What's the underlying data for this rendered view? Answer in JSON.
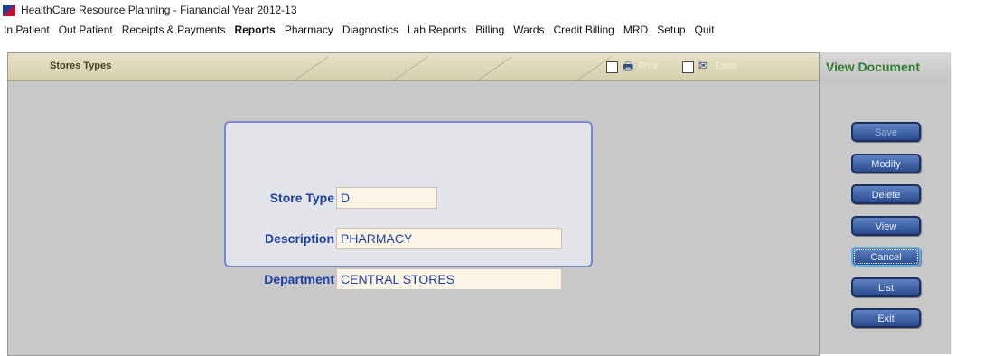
{
  "app": {
    "title": "HealthCare Resource Planning - Fianancial Year 2012-13"
  },
  "menu": [
    {
      "label": "In Patient",
      "bold": false
    },
    {
      "label": "Out Patient",
      "bold": false
    },
    {
      "label": "Receipts & Payments",
      "bold": false
    },
    {
      "label": "Reports",
      "bold": true
    },
    {
      "label": "Pharmacy",
      "bold": false
    },
    {
      "label": "Diagnostics",
      "bold": false
    },
    {
      "label": "Lab Reports",
      "bold": false
    },
    {
      "label": "Billing",
      "bold": false
    },
    {
      "label": "Wards",
      "bold": false
    },
    {
      "label": "Credit Billing",
      "bold": false
    },
    {
      "label": "MRD",
      "bold": false
    },
    {
      "label": "Setup",
      "bold": false
    },
    {
      "label": "Quit",
      "bold": false
    }
  ],
  "toolbar": {
    "title": "Stores Types",
    "print_label": "Print",
    "email_label": "Email"
  },
  "form": {
    "store_type": {
      "label": "Store Type",
      "value": "D"
    },
    "description": {
      "label": "Description",
      "value": "PHARMACY"
    },
    "department": {
      "label": "Department",
      "value": "CENTRAL STORES"
    }
  },
  "sidebar": {
    "title": "View Document",
    "buttons": {
      "save": "Save",
      "modify": "Modify",
      "delete": "Delete",
      "view": "View",
      "cancel": "Cancel",
      "list": "List",
      "exit": "Exit"
    }
  },
  "colors": {
    "label_blue": "#1d3fa6",
    "sidebar_title_green": "#2e7d2e",
    "button_blue": "#2a4a8c"
  }
}
